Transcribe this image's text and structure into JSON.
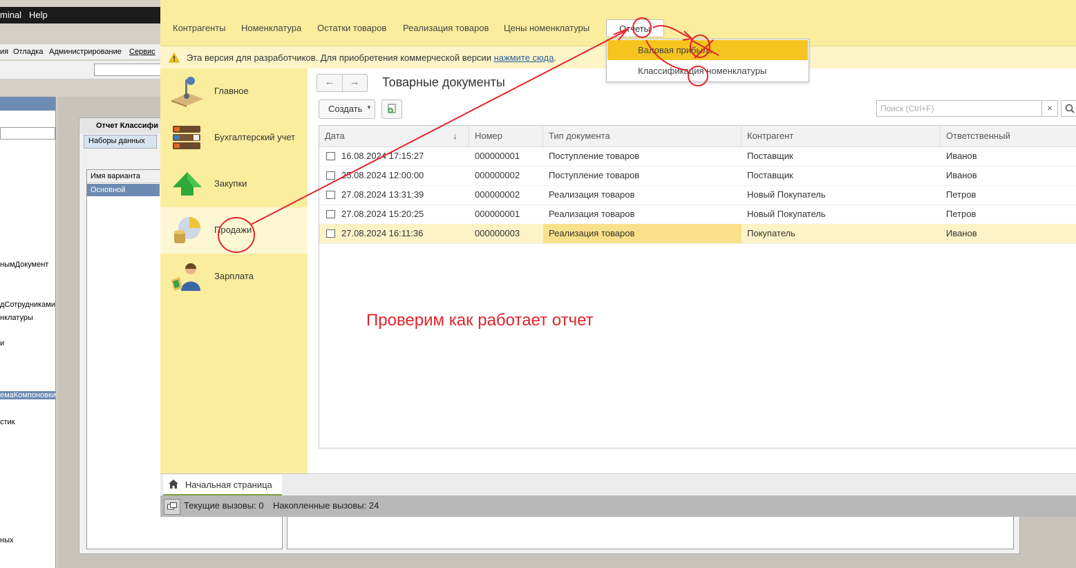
{
  "background": {
    "menubar": [
      "minal",
      "Help"
    ],
    "menu2": [
      "ия",
      "Отладка",
      "Администрирование",
      "Сервис"
    ],
    "left_panel_items": [
      "нымДокумент",
      "дСотрудниками",
      "нклатуры",
      "и",
      "емаКомпоновки",
      "стик",
      "ных"
    ],
    "form_title": "Отчет Классифи",
    "form_tab": "Наборы данных",
    "list_header": "Имя варианта",
    "list_selected": "Основной"
  },
  "sections": [
    "Контрагенты",
    "Номенклатура",
    "Остатки товаров",
    "Реализация товаров",
    "Цены номенклатуры"
  ],
  "reports_button": "Отчеты",
  "reports_menu": [
    "Валовая прибыль",
    "Классификация номенклатуры"
  ],
  "warning": {
    "text": "Эта версия для разработчиков. Для приобретения коммерческой версии",
    "link": "нажмите сюда",
    "tail": "."
  },
  "sidebar": [
    {
      "label": "Главное",
      "icon": "lamp-icon"
    },
    {
      "label": "Бухгалтерский учет",
      "icon": "binders-icon"
    },
    {
      "label": "Закупки",
      "icon": "arrow-up-icon"
    },
    {
      "label": "Продажи",
      "icon": "coins-chart-icon"
    },
    {
      "label": "Зарплата",
      "icon": "person-icon"
    }
  ],
  "page": {
    "title": "Товарные документы",
    "create_label": "Создать",
    "search_placeholder": "Поиск (Ctrl+F)",
    "search_clear": "×"
  },
  "table": {
    "columns": [
      "Дата",
      "Номер",
      "Тип документа",
      "Контрагент",
      "Ответственный"
    ],
    "sort_indicator": "↓",
    "rows": [
      [
        "16.08.2024 17:15:27",
        "000000001",
        "Поступление товаров",
        "Поставщик",
        "Иванов"
      ],
      [
        "25.08.2024 12:00:00",
        "000000002",
        "Поступление товаров",
        "Поставщик",
        "Иванов"
      ],
      [
        "27.08.2024 13:31:39",
        "000000002",
        "Реализация товаров",
        "Новый Покупатель",
        "Петров"
      ],
      [
        "27.08.2024 15:20:25",
        "000000001",
        "Реализация товаров",
        "Новый Покупатель",
        "Петров"
      ],
      [
        "27.08.2024 16:11:36",
        "000000003",
        "Реализация товаров",
        "Покупатель",
        "Иванов"
      ]
    ]
  },
  "home_tab": "Начальная страница",
  "status": {
    "current_calls": "Текущие вызовы: 0",
    "accumulated_calls": "Накопленные вызовы: 24"
  },
  "annotation": "Проверим как работает отчет",
  "colors": {
    "panel_yellow": "#fbed9e",
    "menu_highlight": "#f5c41f",
    "annotation_red": "#e3242b"
  }
}
